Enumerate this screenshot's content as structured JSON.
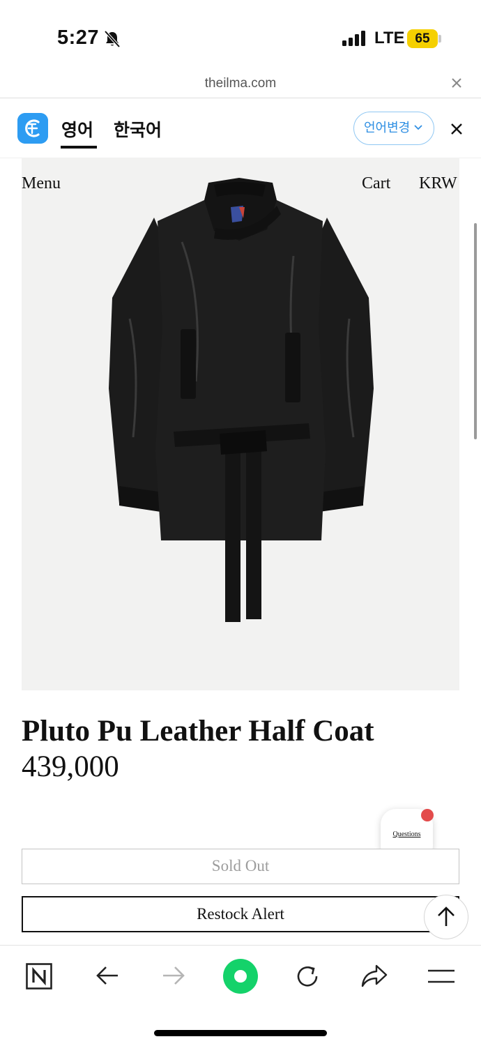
{
  "status_bar": {
    "time": "5:27",
    "network": "LTE",
    "battery_level": "65",
    "battery_color": "#f5d000"
  },
  "browser": {
    "url": "theilma.com"
  },
  "translate_bar": {
    "tab_active": "영어",
    "tab_inactive": "한국어",
    "change_language_label": "언어변경",
    "accent_color": "#2f8fe3"
  },
  "site_nav": {
    "menu": "Menu",
    "cart": "Cart",
    "currency": "KRW"
  },
  "product": {
    "title": "Pluto Pu Leather Half Coat",
    "price": "439,000",
    "sold_out_label": "Sold Out",
    "restock_label": "Restock Alert"
  },
  "questions_widget": {
    "label": "Questions",
    "badge_color": "#e34b4b"
  },
  "icons": {
    "status": [
      "silent-bell-icon",
      "cellular-signal-icon",
      "battery-icon"
    ],
    "toolbar": [
      "naver-n-icon",
      "back-arrow-icon",
      "forward-arrow-icon",
      "green-dot-icon",
      "reload-icon",
      "share-icon",
      "hamburger-menu-icon"
    ]
  }
}
